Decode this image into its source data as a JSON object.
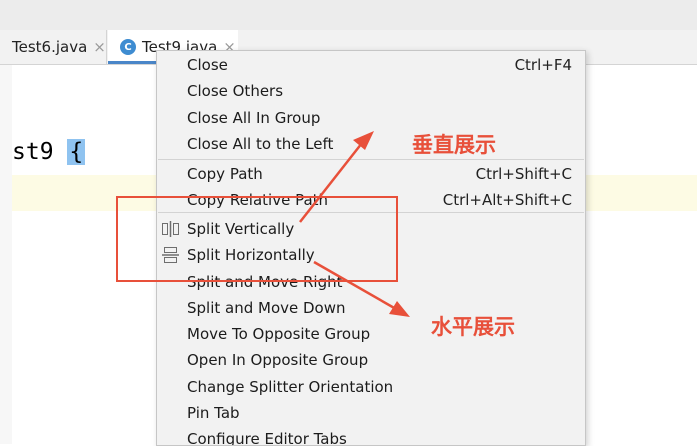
{
  "tabs": [
    {
      "label": "Test6.java",
      "close": "×"
    },
    {
      "icon_letter": "C",
      "label": "Test9.java",
      "close": "×"
    }
  ],
  "editor": {
    "code_text": "st9",
    "brace": "{"
  },
  "menu": {
    "items": [
      {
        "label": "Close",
        "shortcut": "Ctrl+F4"
      },
      {
        "label": "Close Others",
        "shortcut": ""
      },
      {
        "label": "Close All In Group",
        "shortcut": ""
      },
      {
        "label": "Close All to the Left",
        "shortcut": ""
      },
      {
        "label": "Copy Path",
        "shortcut": "Ctrl+Shift+C"
      },
      {
        "label": "Copy Relative Path",
        "shortcut": "Ctrl+Alt+Shift+C"
      },
      {
        "label": "Split Vertically",
        "shortcut": "",
        "icon": "split-vertical-icon"
      },
      {
        "label": "Split Horizontally",
        "shortcut": "",
        "icon": "split-horizontal-icon"
      },
      {
        "label": "Split and Move Right",
        "shortcut": ""
      },
      {
        "label": "Split and Move Down",
        "shortcut": ""
      },
      {
        "label": "Move To Opposite Group",
        "shortcut": ""
      },
      {
        "label": "Open In Opposite Group",
        "shortcut": ""
      },
      {
        "label": "Change Splitter Orientation",
        "shortcut": ""
      },
      {
        "label": "Pin Tab",
        "shortcut": ""
      },
      {
        "label": "Configure Editor Tabs",
        "shortcut": ""
      }
    ]
  },
  "annotations": {
    "vertical_note": "垂直展示",
    "horizontal_note": "水平展示",
    "color": "#e8503a"
  },
  "colors": {
    "accent": "#4a86c8",
    "class_icon": "#3e8cd1",
    "brace_highlight": "#8fc3f0"
  }
}
